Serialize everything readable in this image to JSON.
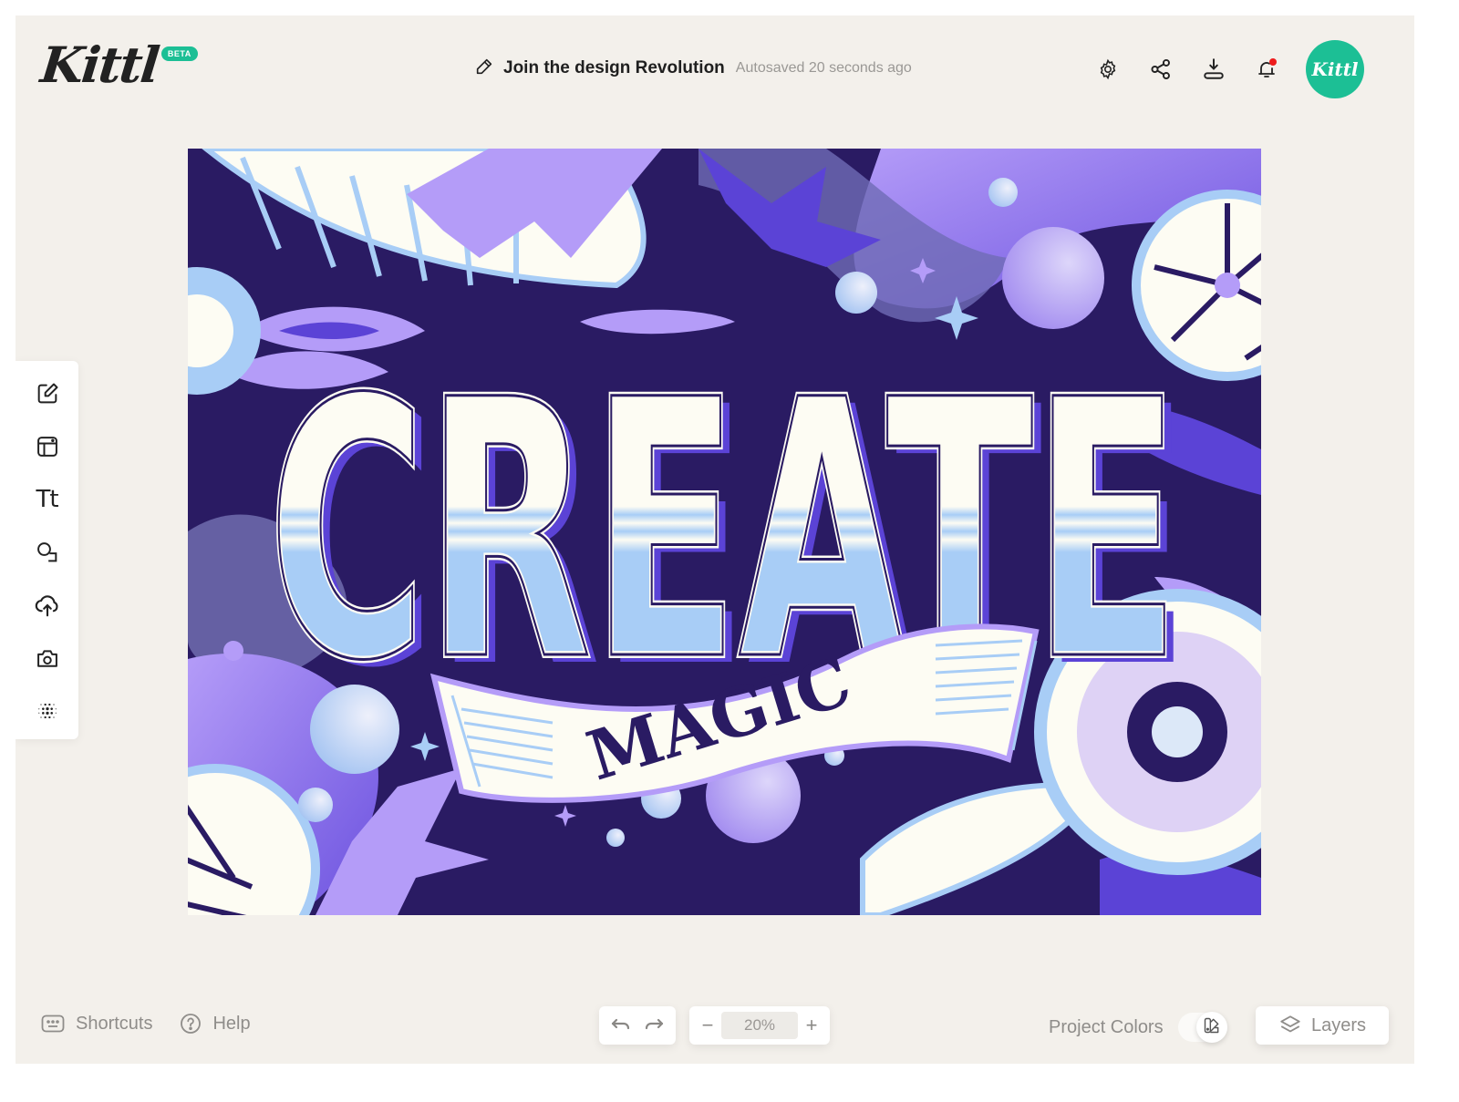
{
  "app": {
    "logo_text": "Kittl",
    "beta_badge": "BETA",
    "avatar_text": "Kittl",
    "brand_color": "#1cbf95"
  },
  "header": {
    "project_title": "Join the design Revolution",
    "autosave_status": "Autosaved 20 seconds ago",
    "icons": [
      "edit-pencil-icon",
      "settings-gear-icon",
      "share-icon",
      "download-icon",
      "notification-bell-icon"
    ],
    "has_unread_notification": true
  },
  "toolbar": {
    "tools": [
      {
        "name": "edit",
        "icon": "edit-square-icon"
      },
      {
        "name": "templates",
        "icon": "layout-icon"
      },
      {
        "name": "text",
        "icon": "text-icon",
        "glyph": "Tt"
      },
      {
        "name": "elements",
        "icon": "shapes-icon"
      },
      {
        "name": "uploads",
        "icon": "cloud-upload-icon"
      },
      {
        "name": "photos",
        "icon": "camera-icon"
      },
      {
        "name": "more",
        "icon": "dots-grid-icon"
      }
    ]
  },
  "canvas": {
    "artwork_headline": "CREATE",
    "artwork_subline": "MAGIC",
    "palette": {
      "background": "#2a1b63",
      "violet": "#b49cf8",
      "indigo": "#5b43d6",
      "sky": "#a8cdf6",
      "cream": "#fdfcf3"
    }
  },
  "footer": {
    "shortcuts_label": "Shortcuts",
    "help_label": "Help",
    "undo_icon": "undo-icon",
    "redo_icon": "redo-icon",
    "zoom_out_label": "−",
    "zoom_level": "20%",
    "zoom_in_label": "+",
    "project_colors_label": "Project Colors",
    "layers_label": "Layers"
  }
}
